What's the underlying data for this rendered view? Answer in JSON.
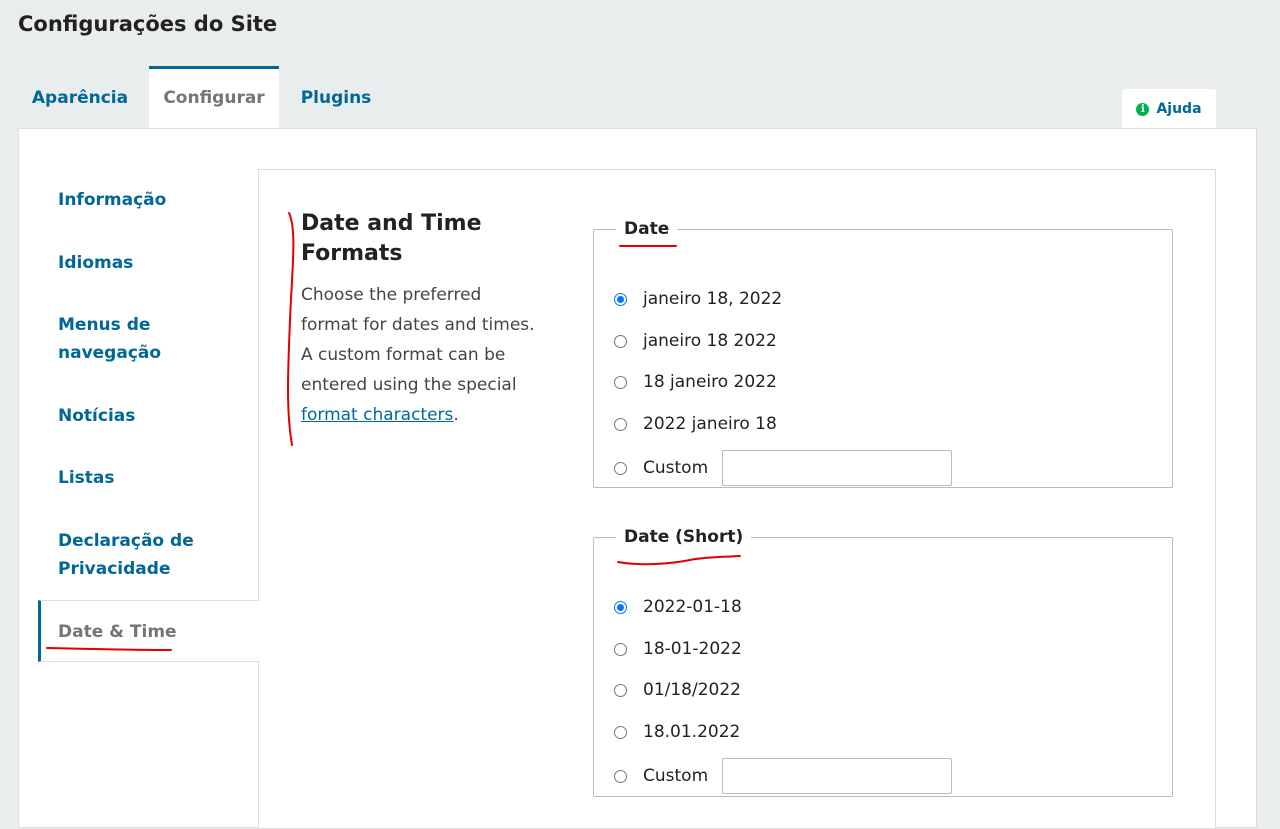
{
  "page": {
    "title": "Configurações do Site"
  },
  "tabs": [
    {
      "label": "Aparência"
    },
    {
      "label": "Configurar"
    },
    {
      "label": "Plugins"
    }
  ],
  "active_tab": "Configurar",
  "help": {
    "label": "Ajuda",
    "icon": "info-circle-icon"
  },
  "sidebar": {
    "items": [
      {
        "label": "Informação"
      },
      {
        "label": "Idiomas"
      },
      {
        "label": "Menus de navegação"
      },
      {
        "label": "Notícias"
      },
      {
        "label": "Listas"
      },
      {
        "label": "Declaração de Privacidade"
      },
      {
        "label": "Date & Time"
      }
    ],
    "active": "Date & Time"
  },
  "section": {
    "title": "Date and Time Formats",
    "description": "Choose the preferred format for dates and times. A custom format can be entered using the special",
    "link_text": "format characters",
    "after_link": "."
  },
  "date_group": {
    "legend": "Date",
    "options": [
      "janeiro 18, 2022",
      "janeiro 18 2022",
      "18 janeiro 2022",
      "2022 janeiro 18"
    ],
    "custom_label": "Custom",
    "custom_value": "",
    "selected": "janeiro 18, 2022"
  },
  "date_short_group": {
    "legend": "Date (Short)",
    "options": [
      "2022-01-18",
      "18-01-2022",
      "01/18/2022",
      "18.01.2022"
    ],
    "custom_label": "Custom",
    "custom_value": "",
    "selected": "2022-01-18"
  },
  "colors": {
    "accent": "#006798",
    "annotation": "#e00000",
    "help_icon": "#00b24e"
  }
}
